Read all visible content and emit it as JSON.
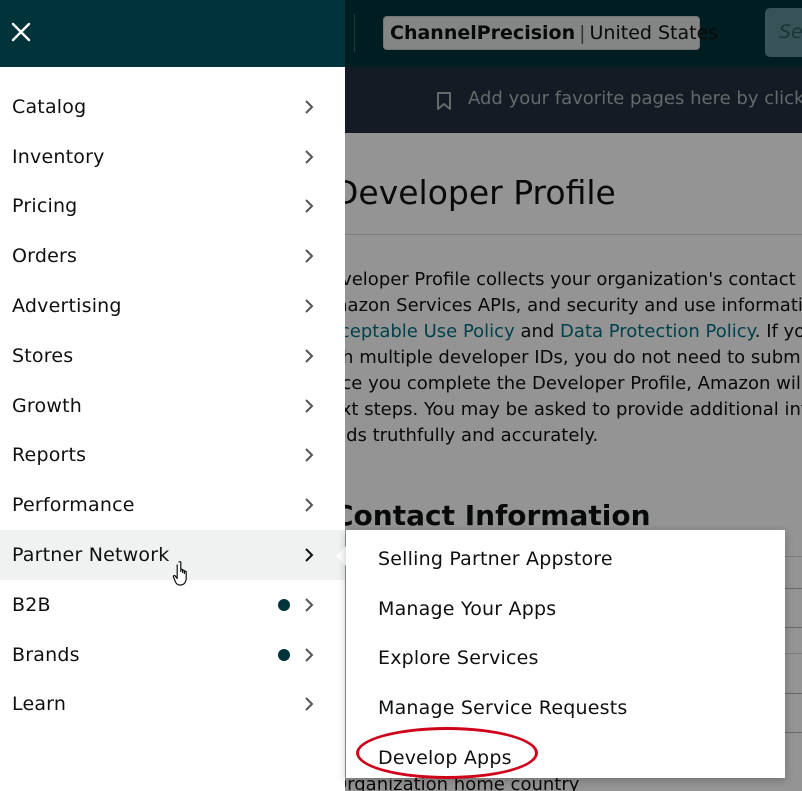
{
  "header": {
    "store_name": "ChannelPrecision",
    "separator": "|",
    "region": "United States",
    "search_button_label": "Se"
  },
  "favorites_bar": {
    "icon": "bookmark-icon",
    "text": "Add your favorite pages here by clickin"
  },
  "page": {
    "title": "Developer Profile",
    "paragraph1": {
      "line1": "eveloper Profile collects your organization's contact in",
      "line2": "mazon Services APIs, and security and use informatio",
      "line3_link1": "cceptable Use Policy",
      "line3_and": " and ",
      "line3_link2": "Data Protection Policy",
      "line3_rest": ". If yo",
      "line4": "ith multiple developer IDs, you do not need to submi"
    },
    "paragraph2": {
      "line1": "nce you complete the Developer Profile, Amazon will",
      "line2": "ext steps. You may be asked to provide additional info",
      "line3": "elds truthfully and accurately."
    },
    "section_heading": "Contact Information",
    "bottom_label": "Organization home country"
  },
  "drawer": {
    "close_icon": "close-icon",
    "items": [
      {
        "label": "Catalog"
      },
      {
        "label": "Inventory"
      },
      {
        "label": "Pricing"
      },
      {
        "label": "Orders"
      },
      {
        "label": "Advertising"
      },
      {
        "label": "Stores"
      },
      {
        "label": "Growth"
      },
      {
        "label": "Reports"
      },
      {
        "label": "Performance"
      },
      {
        "label": "Partner Network",
        "active": true
      },
      {
        "label": "B2B",
        "badge": true
      },
      {
        "label": "Brands",
        "badge": true
      },
      {
        "label": "Learn"
      }
    ]
  },
  "submenu": {
    "parent": "Partner Network",
    "items": [
      {
        "label": "Selling Partner Appstore"
      },
      {
        "label": "Manage Your Apps"
      },
      {
        "label": "Explore Services"
      },
      {
        "label": "Manage Service Requests"
      },
      {
        "label": "Develop Apps",
        "highlighted": true
      }
    ]
  },
  "colors": {
    "header_bg": "#00343a",
    "favbar_bg": "#232f3e",
    "link": "#007185",
    "badge": "#00343a",
    "highlight_ring": "#d0021b"
  }
}
